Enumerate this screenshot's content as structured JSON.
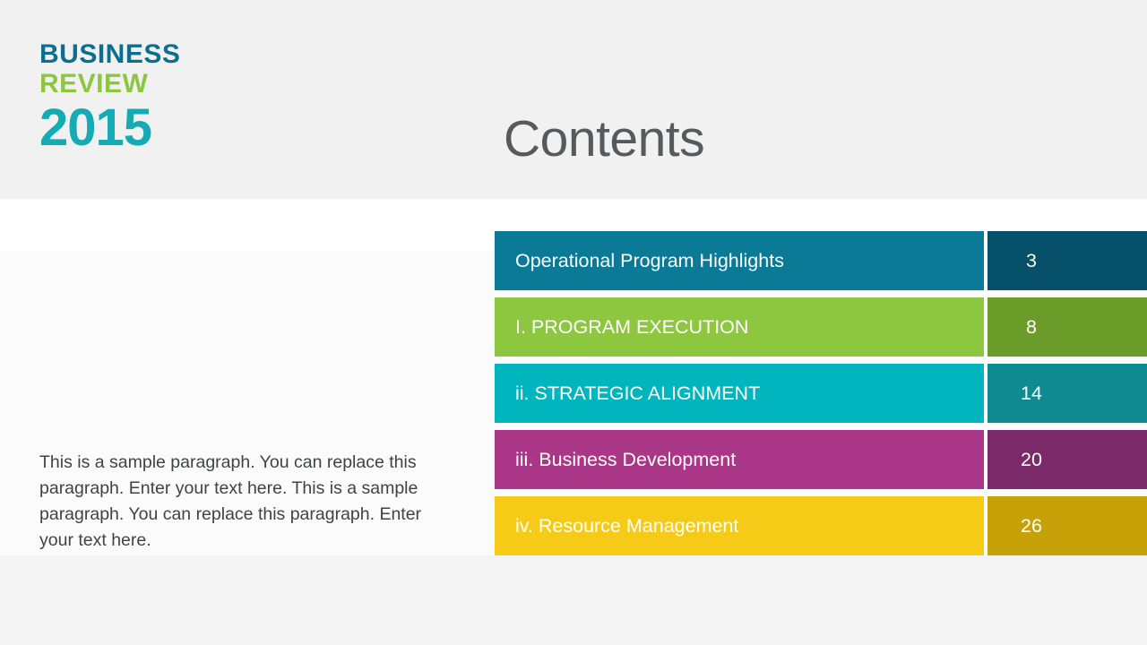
{
  "logo": {
    "line1": "BUSINESS",
    "line2": "REVIEW",
    "year": "2015",
    "color_line1": "#0c6f8f",
    "color_line2": "#8dc63f",
    "color_year": "#14abb4"
  },
  "heading": {
    "title": "Contents",
    "color": "#58595b"
  },
  "paragraph": {
    "text": "This is a sample paragraph. You can replace this paragraph. Enter your text here. This is a sample paragraph. You can replace this paragraph. Enter your text here.",
    "color": "#404246"
  },
  "contents": {
    "rows": [
      {
        "label": "Operational Program Highlights",
        "page": "3",
        "label_color": "#0a7a96",
        "page_color": "#06506a"
      },
      {
        "label": "I. PROGRAM EXECUTION",
        "page": "8",
        "label_color": "#8dc63f",
        "page_color": "#6b9b28"
      },
      {
        "label": "ii. STRATEGIC ALIGNMENT",
        "page": "14",
        "label_color": "#00b5bd",
        "page_color": "#0e8a90"
      },
      {
        "label": "iii. Business Development",
        "page": "20",
        "label_color": "#a93687",
        "page_color": "#7a2a69"
      },
      {
        "label": "iv. Resource Management",
        "page": "26",
        "label_color": "#f5cb18",
        "page_color": "#c7a108"
      }
    ]
  },
  "background": {
    "header_band": "#f1f1f1",
    "body_band": "#fbfbfb",
    "footer_band": "#f4f4f4"
  }
}
